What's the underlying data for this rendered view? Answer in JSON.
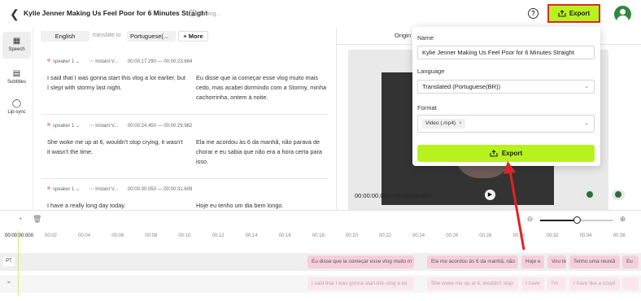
{
  "header": {
    "title": "Kylie Jenner Making Us Feel Poor for 6 Minutes Straight",
    "saving": "Saving...",
    "help": "?",
    "export_label": "Export"
  },
  "colors": {
    "accent": "#b7f21f",
    "highlight": "#d92b2b",
    "clip_target": "#f7cfdc",
    "clip_source": "#fbe6ee"
  },
  "rail": {
    "items": [
      {
        "label": "Speech",
        "icon": "speech-icon",
        "active": true
      },
      {
        "label": "Subtitles",
        "icon": "subtitles-icon",
        "active": false
      },
      {
        "label": "Lip-sync",
        "icon": "lipsync-icon",
        "active": false
      }
    ]
  },
  "editor": {
    "source_lang": "English",
    "to_text": "translate to",
    "target_lang": "Portuguese(...",
    "more_label": "+ More",
    "segments": [
      {
        "speaker": "speaker 1",
        "voice": "Instant V...",
        "start": "00:00:17.290",
        "end": "00:00:23.664",
        "source": "I said that I was gonna start this vlog a lot earlier, but I slept with stormy last night.",
        "target": "Eu disse que ia começar esse vlog muito mais cedo, mas acabei dormindo com a Stormy, minha cachorrinha, ontem à noite."
      },
      {
        "speaker": "speaker 1",
        "voice": "Instant V...",
        "start": "00:00:24.450",
        "end": "00:00:29.962",
        "source": "She woke me up at 6, wouldn't stop crying, it wasn't it wasn't the time.",
        "target": "Ela me acordou às 6 da manhã, não parava de chorar e eu sabia que não era a hora certa para isso."
      },
      {
        "speaker": "speaker 1",
        "voice": "Instant V...",
        "start": "00:00:30.050",
        "end": "00:00:31.609",
        "source": "I have a really long day today.",
        "target": "Hoje eu tenho um dia bem longo."
      }
    ]
  },
  "preview": {
    "tab_label": "Origin",
    "time_current": "00:00:00.000",
    "time_total": "00:06:08.852",
    "time_sep": " / "
  },
  "export_panel": {
    "name_label": "Name",
    "name_value": "Kylie Jenner Making Us Feel Poor for 6 Minutes Straight",
    "language_label": "Language",
    "language_value": "Translated (Portuguese(BR))",
    "format_label": "Format",
    "format_value": "Video (.mp4)",
    "export_button": "Export"
  },
  "timeline": {
    "zoom_level": 0.5,
    "ticks": [
      "00:00:00.000",
      "00:02",
      "00:04",
      "00:06",
      "00:08",
      "00:10",
      "00:12",
      "00:14",
      "00:16",
      "00:18",
      "00:20",
      "00:22",
      "00:24",
      "00:26",
      "00:28",
      "00:30",
      "00:32",
      "00:34",
      "00:36"
    ],
    "row_pt_label": "PT",
    "pt_clips": [
      "Eu disse que ia começar esse vlog muito m",
      "Ela me acordou às 6 da manhã, não",
      "Hoje e",
      "Vou te",
      "Tenho uma reuniã",
      "Eu"
    ],
    "src_clips": [
      "I said that I was gonna start this vlog a lot",
      "She woke me up at 6, wouldn't stop",
      "I have",
      "I'm",
      "I have like a coupl",
      ""
    ]
  }
}
